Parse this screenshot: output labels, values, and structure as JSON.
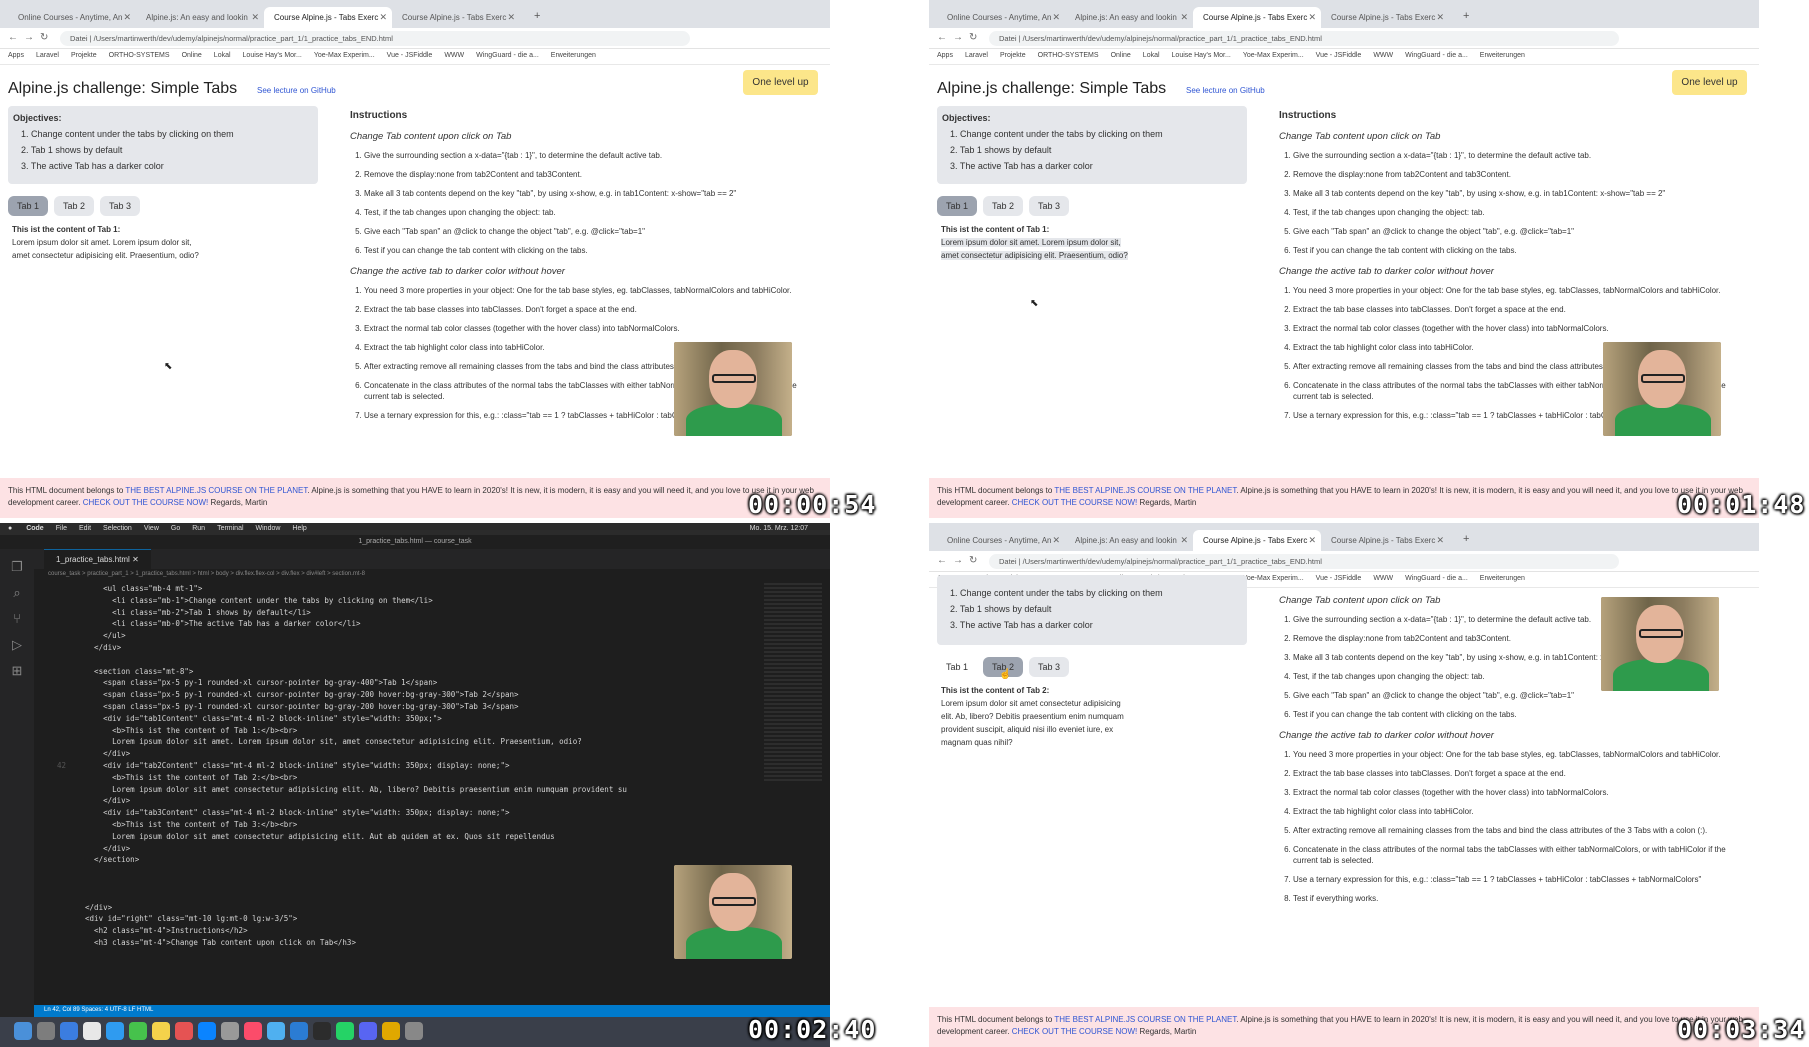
{
  "timestamps": [
    "00:00:54",
    "00:01:48",
    "00:02:40",
    "00:03:34"
  ],
  "browser": {
    "tabs": [
      "Online Courses - Anytime, An",
      "Alpine.js: An easy and lookin",
      "Course Alpine.js - Tabs Exerc",
      "Course Alpine.js - Tabs Exerc"
    ],
    "url": "Datei | /Users/martinwerth/dev/udemy/alpinejs/normal/practice_part_1/1_practice_tabs_END.html",
    "bookmarks": [
      "Apps",
      "Laravel",
      "Projekte",
      "ORTHO-SYSTEMS",
      "Online",
      "Lokal",
      "Louise Hay's Mor...",
      "Yoe-Max Experim...",
      "Vue - JSFiddle",
      "WWW",
      "WingGuard - die a...",
      "Erweiterungen"
    ]
  },
  "page": {
    "title": "Alpine.js challenge: Simple Tabs",
    "github_link": "See lecture on GitHub",
    "level_up": "One level up",
    "objectives_title": "Objectives:",
    "objectives": [
      "1. Change content under the tabs by clicking on them",
      "2. Tab 1 shows by default",
      "3. The active Tab has a darker color"
    ],
    "tab_labels": [
      "Tab 1",
      "Tab 2",
      "Tab 3"
    ],
    "tab1_heading": "This ist the content of Tab 1:",
    "tab1_text": "Lorem ipsum dolor sit amet. Lorem ipsum dolor sit, amet consectetur adipisicing elit. Praesentium, odio?",
    "tab2_heading": "This ist the content of Tab 2:",
    "tab2_text": "Lorem ipsum dolor sit amet consectetur adipisicing elit. Ab, libero? Debitis praesentium enim numquam provident suscipit, aliquid nisi illo eveniet iure, ex magnam quas nihil?",
    "instructions_title": "Instructions",
    "section1_title": "Change Tab content upon click on Tab",
    "section1_steps": [
      "Give the surrounding section a x-data=\"{tab : 1}\", to determine the default active tab.",
      "Remove the display:none from tab2Content and tab3Content.",
      "Make all 3 tab contents depend on the key \"tab\", by using x-show, e.g. in tab1Content: x-show=\"tab == 2\"",
      "Test, if the tab changes upon changing the object: tab.",
      "Give each \"Tab span\" an @click to change the object \"tab\", e.g. @click=\"tab=1\"",
      "Test if you can change the tab content with clicking on the tabs."
    ],
    "section2_title": "Change the active tab to darker color without hover",
    "section2_steps": [
      "You need 3 more properties in your object: One for the tab base styles, eg. tabClasses, tabNormalColors and tabHiColor.",
      "Extract the tab base classes into tabClasses. Don't forget a space at the end.",
      "Extract the normal tab color classes (together with the hover class) into tabNormalColors.",
      "Extract the tab highlight color class into tabHiColor.",
      "After extracting remove all remaining classes from the tabs and bind the class attributes of the 3 Tabs with a colon (:).",
      "Concatenate in the class attributes of the normal tabs the tabClasses with either tabNormalColors, or with tabHiColor if the current tab is selected.",
      "Use a ternary expression for this, e.g.: :class=\"tab == 1 ? tabClasses + tabHiColor : tabClasses + tabNormalColors\"",
      "Test if everything works."
    ],
    "footer_text_1": "This HTML document belongs to",
    "footer_link_1": "THE BEST ALPINE.JS COURSE ON THE PLANET",
    "footer_text_2": ". Alpine.js is something that you HAVE to learn in 2020's! It is new, it is modern, it is easy and you will need it, and you love to use it in your web development career.",
    "footer_link_2": "CHECK OUT THE COURSE NOW!",
    "footer_text_3": "Regards, Martin"
  },
  "vscode": {
    "menu": [
      "Code",
      "File",
      "Edit",
      "Selection",
      "View",
      "Go",
      "Run",
      "Terminal",
      "Window",
      "Help"
    ],
    "clock": "Mo. 15. Mrz. 12:07",
    "window_title": "1_practice_tabs.html — course_task",
    "file_tab": "1_practice_tabs.html",
    "breadcrumb": "course_task > practice_part_1 > 1_practice_tabs.html > html > body > div.flex.flex-col > div.flex > div#left > section.mt-8",
    "status": "Ln 42, Col 89   Spaces: 4   UTF-8   LF   HTML",
    "code_lines": [
      {
        "n": "",
        "c": "      <ul class=\"mb-4 mt-1\">"
      },
      {
        "n": "",
        "c": "        <li class=\"mb-1\">Change content under the tabs by clicking on them</li>"
      },
      {
        "n": "",
        "c": "        <li class=\"mb-2\">Tab 1 shows by default</li>"
      },
      {
        "n": "",
        "c": "        <li class=\"mb-0\">The active Tab has a darker color</li>"
      },
      {
        "n": "",
        "c": "      </ul>"
      },
      {
        "n": "",
        "c": "    </div>"
      },
      {
        "n": "",
        "c": ""
      },
      {
        "n": "",
        "c": "    <section class=\"mt-8\">"
      },
      {
        "n": "",
        "c": "      <span class=\"px-5 py-1 rounded-xl cursor-pointer bg-gray-400\">Tab 1</span>"
      },
      {
        "n": "",
        "c": "      <span class=\"px-5 py-1 rounded-xl cursor-pointer bg-gray-200 hover:bg-gray-300\">Tab 2</span>"
      },
      {
        "n": "",
        "c": "      <span class=\"px-5 py-1 rounded-xl cursor-pointer bg-gray-200 hover:bg-gray-300\">Tab 3</span>"
      },
      {
        "n": "",
        "c": "      <div id=\"tab1Content\" class=\"mt-4 ml-2 block-inline\" style=\"width: 350px;\">"
      },
      {
        "n": "",
        "c": "        <b>This ist the content of Tab 1:</b><br>"
      },
      {
        "n": "",
        "c": "        Lorem ipsum dolor sit amet. Lorem ipsum dolor sit, amet consectetur adipisicing elit. Praesentium, odio?"
      },
      {
        "n": "",
        "c": "      </div>"
      },
      {
        "n": "42",
        "c": "      <div id=\"tab2Content\" class=\"mt-4 ml-2 block-inline\" style=\"width: 350px; display: none;\">"
      },
      {
        "n": "",
        "c": "        <b>This ist the content of Tab 2:</b><br>"
      },
      {
        "n": "",
        "c": "        Lorem ipsum dolor sit amet consectetur adipisicing elit. Ab, libero? Debitis praesentium enim numquam provident su"
      },
      {
        "n": "",
        "c": "      </div>"
      },
      {
        "n": "",
        "c": "      <div id=\"tab3Content\" class=\"mt-4 ml-2 block-inline\" style=\"width: 350px; display: none;\">"
      },
      {
        "n": "",
        "c": "        <b>This ist the content of Tab 3:</b><br>"
      },
      {
        "n": "",
        "c": "        Lorem ipsum dolor sit amet consectetur adipisicing elit. Aut ab quidem at ex. Quos sit repellendus"
      },
      {
        "n": "",
        "c": "      </div>"
      },
      {
        "n": "",
        "c": "    </section>"
      },
      {
        "n": "",
        "c": ""
      },
      {
        "n": "",
        "c": ""
      },
      {
        "n": "",
        "c": ""
      },
      {
        "n": "",
        "c": "  </div>"
      },
      {
        "n": "",
        "c": "  <div id=\"right\" class=\"mt-10 lg:mt-0 lg:w-3/5\">"
      },
      {
        "n": "",
        "c": "    <h2 class=\"mt-4\">Instructions</h2>"
      },
      {
        "n": "",
        "c": "    <h3 class=\"mt-4\">Change Tab content upon click on Tab</h3>"
      }
    ]
  }
}
